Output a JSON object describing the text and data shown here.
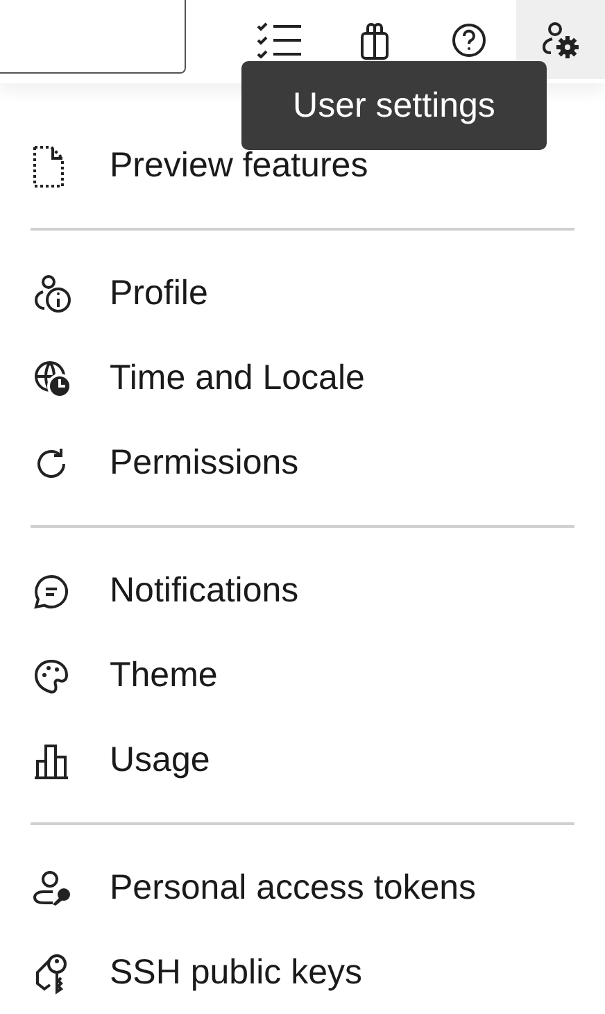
{
  "toolbar": {
    "buttons": [
      {
        "selected": false
      },
      {
        "selected": false
      },
      {
        "selected": false
      },
      {
        "selected": true
      }
    ]
  },
  "tooltip": {
    "text": "User settings"
  },
  "menu": {
    "groups": [
      [
        {
          "label": "Preview features"
        }
      ],
      [
        {
          "label": "Profile"
        },
        {
          "label": "Time and Locale"
        },
        {
          "label": "Permissions"
        }
      ],
      [
        {
          "label": "Notifications"
        },
        {
          "label": "Theme"
        },
        {
          "label": "Usage"
        }
      ],
      [
        {
          "label": "Personal access tokens"
        },
        {
          "label": "SSH public keys"
        }
      ]
    ]
  }
}
